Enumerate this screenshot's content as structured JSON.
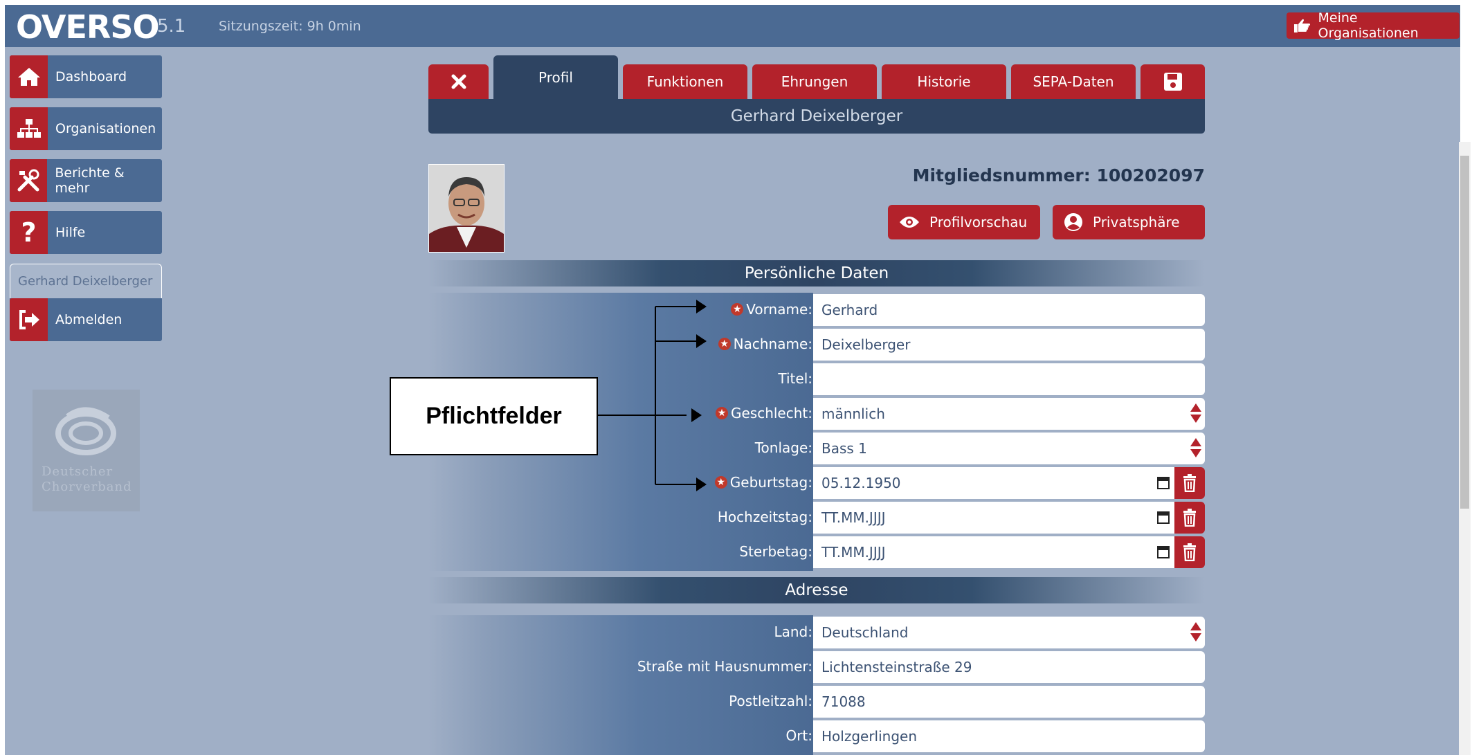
{
  "topbar": {
    "logo": "OVERSO",
    "version": "5.1",
    "session": "Sitzungszeit: 9h 0min",
    "org_button": "Meine Organisationen"
  },
  "sidebar": {
    "items": [
      {
        "label": "Dashboard",
        "icon": "home-icon"
      },
      {
        "label": "Organisationen",
        "icon": "sitemap-icon"
      },
      {
        "label": "Berichte & mehr",
        "icon": "tools-icon"
      },
      {
        "label": "Hilfe",
        "icon": "question-icon"
      }
    ],
    "user": "Gerhard Deixelberger",
    "logout": "Abmelden",
    "logo_line1": "Deutscher",
    "logo_line2": "Chorverband"
  },
  "tabs": [
    {
      "label": "Profil",
      "active": true
    },
    {
      "label": "Funktionen"
    },
    {
      "label": "Ehrungen"
    },
    {
      "label": "Historie"
    },
    {
      "label": "SEPA-Daten"
    }
  ],
  "profile": {
    "name": "Gerhard Deixelberger",
    "member_number": "Mitgliedsnummer: 100202097",
    "preview_button": "Profilvorschau",
    "privacy_button": "Privatsphäre"
  },
  "sections": {
    "personal": "Persönliche Daten",
    "address": "Adresse"
  },
  "personal_fields": [
    {
      "label": "Vorname:",
      "value": "Gerhard",
      "required": true
    },
    {
      "label": "Nachname:",
      "value": "Deixelberger",
      "required": true
    },
    {
      "label": "Titel:",
      "value": "",
      "required": false
    },
    {
      "label": "Geschlecht:",
      "value": "männlich",
      "required": true
    },
    {
      "label": "Tonlage:",
      "value": "Bass 1",
      "required": false
    },
    {
      "label": "Geburtstag:",
      "value": "05.12.1950",
      "required": true
    },
    {
      "label": "Hochzeitstag:",
      "value": "TT.MM.JJJJ",
      "required": false
    },
    {
      "label": "Sterbetag:",
      "value": "TT.MM.JJJJ",
      "required": false
    }
  ],
  "address_fields": [
    {
      "label": "Land:",
      "value": "Deutschland"
    },
    {
      "label": "Straße mit Hausnummer:",
      "value": "Lichtensteinstraße 29"
    },
    {
      "label": "Postleitzahl:",
      "value": "71088"
    },
    {
      "label": "Ort:",
      "value": "Holzgerlingen"
    }
  ],
  "annotation": {
    "callout": "Pflichtfelder"
  },
  "colors": {
    "accent_red": "#b3222b",
    "topbar": "#4b6a93",
    "dark_navy": "#2e4462",
    "background": "#a0afc6"
  }
}
